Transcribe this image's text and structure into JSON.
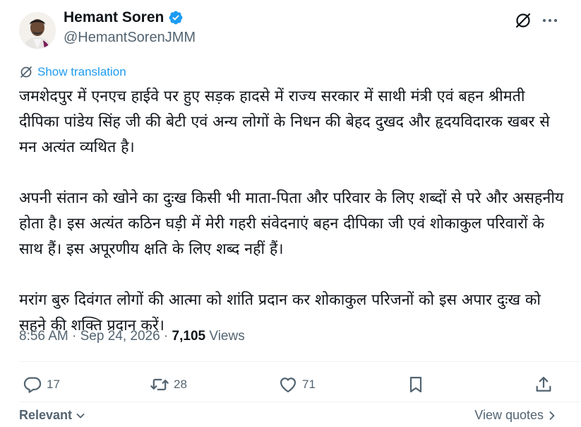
{
  "author": {
    "display_name": "Hemant Soren",
    "handle": "@HemantSorenJMM",
    "verified": true
  },
  "translate": {
    "label": "Show translation"
  },
  "tweet": {
    "paragraphs": [
      "जमशेदपुर में एनएच हाईवे पर हुए सड़क हादसे में राज्य सरकार में साथी मंत्री एवं बहन श्रीमती दीपिका पांडेय सिंह जी की बेटी एवं अन्य लोगों के निधन की बेहद दुखद और हृदयविदारक खबर से मन अत्यंत व्यथित है।",
      "अपनी संतान को खोने का दुःख किसी भी माता-पिता और परिवार के लिए शब्दों से परे और असहनीय होता है। इस अत्यंत कठिन घड़ी में मेरी गहरी संवेदनाएं बहन दीपिका जी एवं शोकाकुल परिवारों के साथ हैं। इस अपूरणीय क्षति के लिए शब्द नहीं हैं।",
      "मरांग बुरु दिवंगत लोगों की आत्मा को शांति प्रदान कर शोकाकुल परिजनों को इस अपार दुःख को सहने की शक्ति प्रदान करें।"
    ]
  },
  "meta": {
    "time": "8:56 AM",
    "separator": " · ",
    "date": "Sep 24, 2026",
    "views_count": "7,105",
    "views_label": " Views"
  },
  "actions": {
    "replies": "17",
    "reposts": "28",
    "likes": "71"
  },
  "footer": {
    "sort_label": "Relevant",
    "view_quotes_label": "View quotes"
  },
  "colors": {
    "accent": "#1d9bf0",
    "secondary_text": "#536471",
    "primary_text": "#0f1419"
  }
}
